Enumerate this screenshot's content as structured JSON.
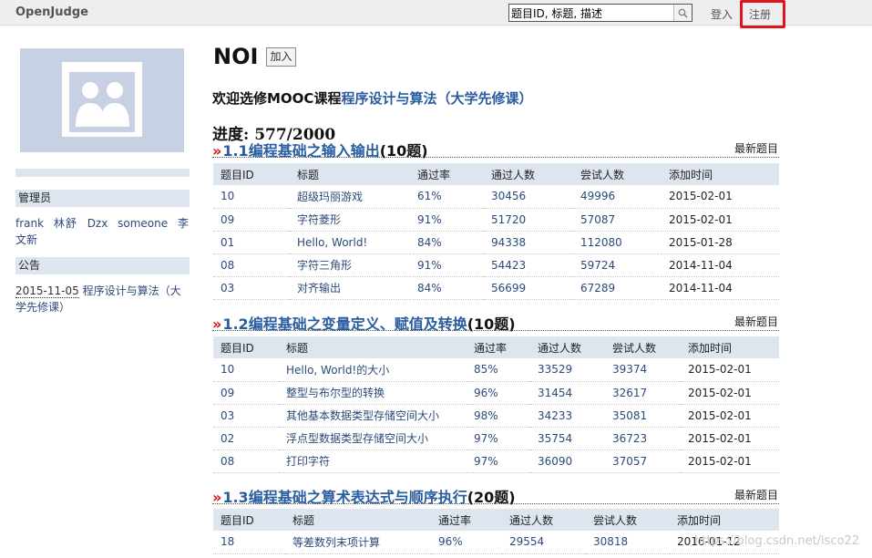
{
  "topbar": {
    "brand": "OpenJudge",
    "search_value": "题目ID, 标题, 描述",
    "login": "登入",
    "register": "注册"
  },
  "sidebar": {
    "admins_label": "管理员",
    "admins": [
      "frank",
      "林舒",
      "Dzx",
      "someone",
      "李文新"
    ],
    "notice_label": "公告",
    "notice_date": "2015-11-05",
    "notice_text": "程序设计与算法（大学先修课）"
  },
  "main": {
    "group_title": "NOI",
    "join_label": "加入",
    "welcome_prefix": "欢迎选修MOOC课程",
    "welcome_course": "程序设计与算法（大学先修课）",
    "progress": "进度: 577/2000",
    "newest_label": "最新题目",
    "sections": [
      {
        "chevron": "»",
        "title": "1.1编程基础之输入输出",
        "count": "(10题)",
        "headers": [
          "题目ID",
          "标题",
          "通过率",
          "通过人数",
          "尝试人数",
          "添加时间"
        ],
        "rows": [
          [
            "10",
            "超级玛丽游戏",
            "61%",
            "30456",
            "49996",
            "2015-02-01"
          ],
          [
            "09",
            "字符菱形",
            "91%",
            "51720",
            "57087",
            "2015-02-01"
          ],
          [
            "01",
            "Hello, World!",
            "84%",
            "94338",
            "112080",
            "2015-01-28"
          ],
          [
            "08",
            "字符三角形",
            "91%",
            "54423",
            "59724",
            "2014-11-04"
          ],
          [
            "03",
            "对齐输出",
            "84%",
            "56699",
            "67289",
            "2014-11-04"
          ]
        ]
      },
      {
        "chevron": "»",
        "title": "1.2编程基础之变量定义、赋值及转换",
        "count": "(10题)",
        "headers": [
          "题目ID",
          "标题",
          "通过率",
          "通过人数",
          "尝试人数",
          "添加时间"
        ],
        "rows": [
          [
            "10",
            "Hello, World!的大小",
            "85%",
            "33529",
            "39374",
            "2015-02-01"
          ],
          [
            "09",
            "整型与布尔型的转换",
            "96%",
            "31454",
            "32617",
            "2015-02-01"
          ],
          [
            "03",
            "其他基本数据类型存储空间大小",
            "98%",
            "34233",
            "35081",
            "2015-02-01"
          ],
          [
            "02",
            "浮点型数据类型存储空间大小",
            "97%",
            "35754",
            "36723",
            "2015-02-01"
          ],
          [
            "08",
            "打印字符",
            "97%",
            "36090",
            "37057",
            "2015-02-01"
          ]
        ]
      },
      {
        "chevron": "»",
        "title": "1.3编程基础之算术表达式与顺序执行",
        "count": "(20题)",
        "headers": [
          "题目ID",
          "标题",
          "通过率",
          "通过人数",
          "尝试人数",
          "添加时间"
        ],
        "rows": [
          [
            "18",
            "等差数列末项计算",
            "96%",
            "29554",
            "30818",
            "2016-01-12"
          ]
        ]
      }
    ]
  },
  "watermark": "https://blog.csdn.net/isco22"
}
